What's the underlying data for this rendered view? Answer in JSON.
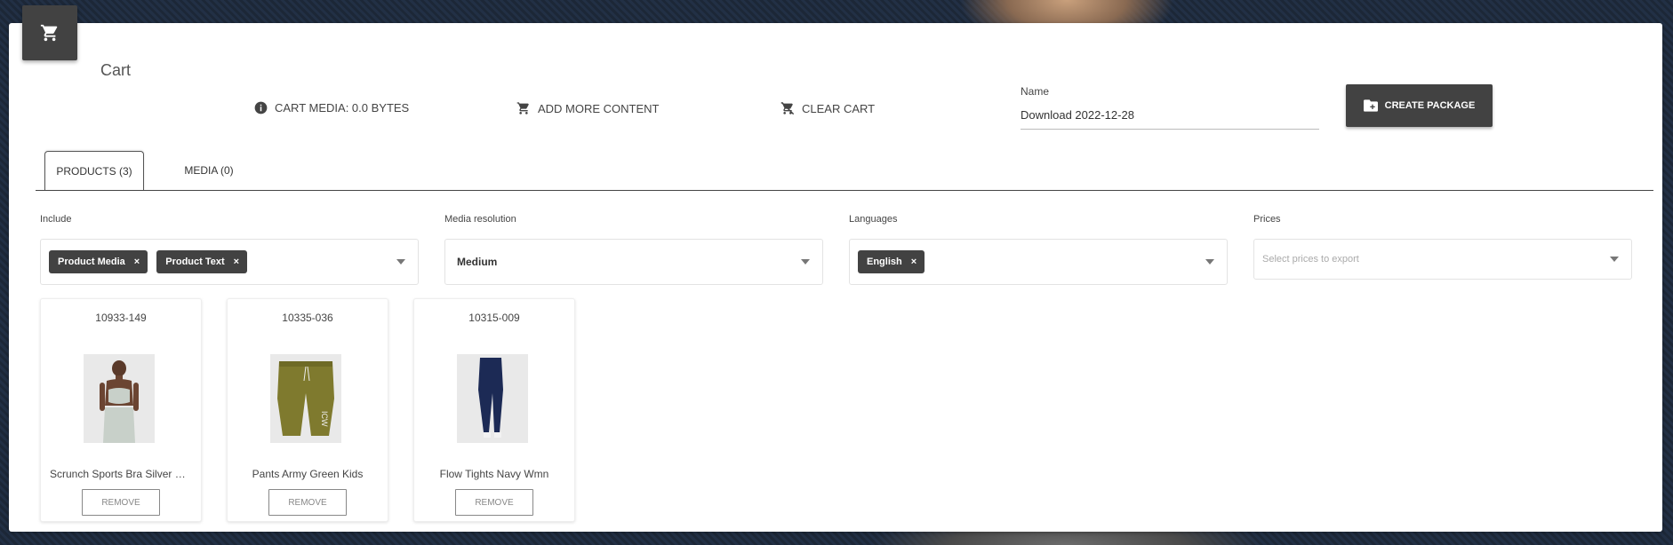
{
  "header": {
    "title": "Cart",
    "cart_icon": "shopping-cart-icon"
  },
  "actions": {
    "cart_media": "CART MEDIA: 0.0 BYTES",
    "add_more": "ADD MORE CONTENT",
    "clear_cart": "CLEAR CART"
  },
  "name_field": {
    "label": "Name",
    "value": "Download 2022-12-28"
  },
  "create_package": {
    "label": "CREATE PACKAGE"
  },
  "tabs": [
    {
      "label": "PRODUCTS (3)",
      "active": true
    },
    {
      "label": "MEDIA (0)",
      "active": false
    }
  ],
  "filters": {
    "include": {
      "label": "Include",
      "chips": [
        "Product Media",
        "Product Text"
      ]
    },
    "media_resolution": {
      "label": "Media resolution",
      "value": "Medium"
    },
    "languages": {
      "label": "Languages",
      "chips": [
        "English"
      ]
    },
    "prices": {
      "label": "Prices",
      "placeholder": "Select prices to export"
    }
  },
  "products": [
    {
      "sku": "10933-149",
      "name": "Scrunch Sports Bra Silver Mi...",
      "remove_label": "REMOVE"
    },
    {
      "sku": "10335-036",
      "name": "Pants Army Green Kids",
      "remove_label": "REMOVE"
    },
    {
      "sku": "10315-009",
      "name": "Flow Tights Navy Wmn",
      "remove_label": "REMOVE"
    }
  ],
  "colors": {
    "dark": "#424242",
    "card": "#ffffff",
    "background": "#1e2a3a"
  }
}
